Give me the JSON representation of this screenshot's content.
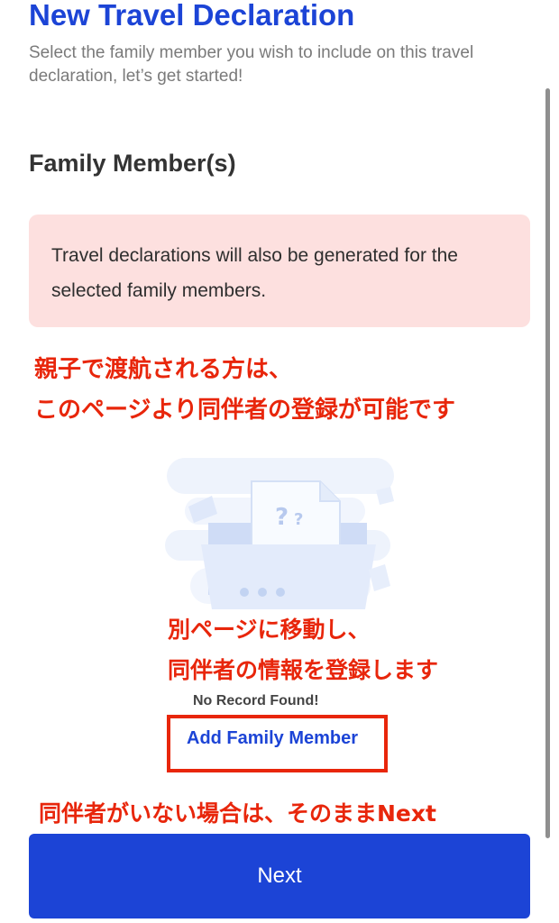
{
  "header": {
    "title": "New Travel Declaration",
    "subtitle": "Select the family member you wish to include on this travel declaration, let’s get started!"
  },
  "family_section": {
    "title": "Family Member(s)",
    "notice": "Travel declarations will also be generated for the selected family members.",
    "empty_state": {
      "illustration": "empty-folder-icon",
      "message": "No Record Found!",
      "add_link": "Add Family Member"
    }
  },
  "annotations": {
    "line1": "親子で渡航される方は、",
    "line2": "このページより同伴者の登録が可能です",
    "line3": "別ページに移動し、",
    "line4": "同伴者の情報を登録します",
    "line5": "同伴者がいない場合は、そのままNext"
  },
  "footer": {
    "next_label": "Next"
  },
  "colors": {
    "brand_blue": "#1c44d6",
    "notice_bg": "#fde0df",
    "annotation_red": "#e8260b"
  }
}
